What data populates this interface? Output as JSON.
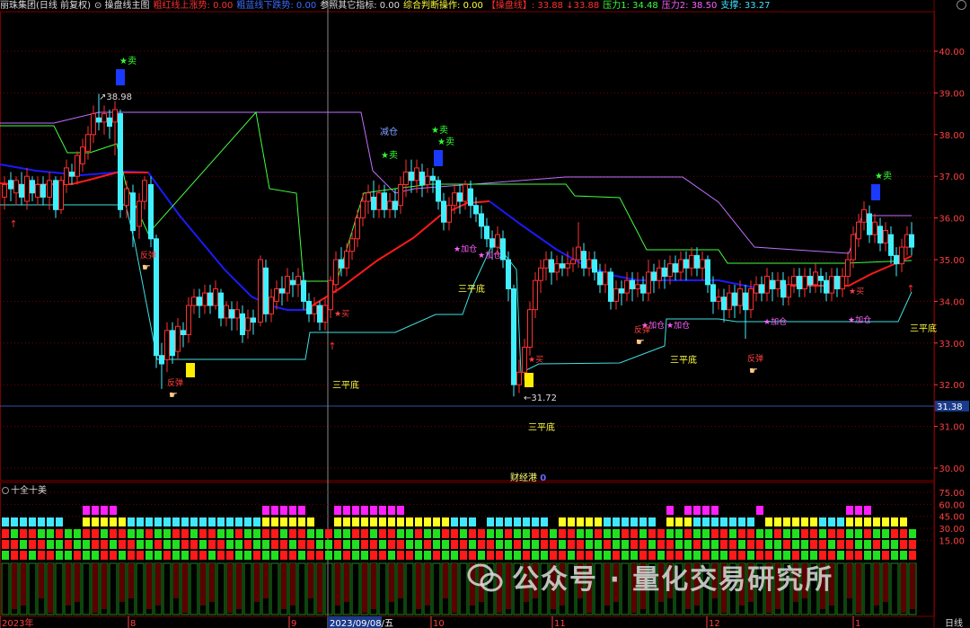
{
  "header": {
    "items": [
      {
        "text": "丽珠集团(日线 前复权)",
        "color": "#dddddd"
      },
      {
        "text": "⊙ 操盘线主图",
        "color": "#dddddd"
      },
      {
        "text": "粗红线上涨势: 0.00",
        "color": "#ff3030"
      },
      {
        "text": "粗蓝线下跌势: 0.00",
        "color": "#3c6cff"
      },
      {
        "text": "参照其它指标: 0.00",
        "color": "#dddddd"
      },
      {
        "text": "综合判断操作: 0.00",
        "color": "#ffff40"
      },
      {
        "text": "【操盘线】: 33.88 ↓33.88",
        "color": "#ff3030"
      },
      {
        "text": "压力1: 34.48",
        "color": "#40ff40"
      },
      {
        "text": "压力2: 38.50",
        "color": "#ff60ff"
      },
      {
        "text": "支撑: 33.27",
        "color": "#40e0ff"
      }
    ]
  },
  "main_axis": {
    "ticks": [
      "40.00",
      "39.00",
      "38.00",
      "37.00",
      "36.00",
      "35.00",
      "34.00",
      "33.00",
      "32.00",
      "31.00",
      "30.00"
    ],
    "current_price": "31.38"
  },
  "sub_panel": {
    "title": "十全十美",
    "ticks": [
      "75.00",
      "60.00",
      "45.00",
      "30.00",
      "15.00"
    ],
    "badge_left": "财",
    "badge_text": "财经港",
    "badge_num": "0"
  },
  "x_axis": {
    "labels": [
      "2023年",
      "8",
      "9",
      "2023/09/08/五",
      "10",
      "11",
      "12",
      "1"
    ],
    "period": "日线"
  },
  "annotations": {
    "high": "38.98",
    "low": "31.72",
    "sell": "★卖",
    "buy": "★买",
    "add": "★加仓",
    "reduce": "减仓",
    "bounce": "反弹",
    "triple_bottom": "三平底"
  },
  "watermark": "公众号 · 量化交易研究所",
  "colors": {
    "up": "#ff3030",
    "down": "#40f0ff",
    "ma_red": "#ff1a1a",
    "ma_blue": "#1a1aff",
    "resist1": "#40ff40",
    "resist2": "#c070ff",
    "support": "#40e0e0",
    "grid": "#7a0000"
  }
}
